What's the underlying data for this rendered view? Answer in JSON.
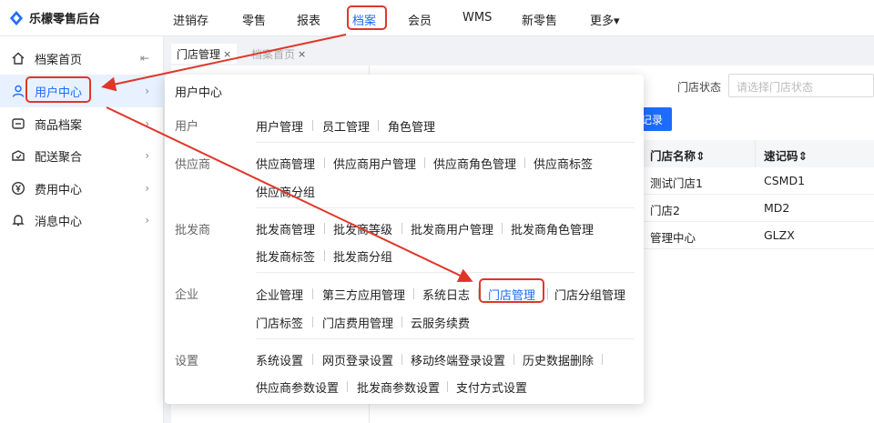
{
  "app": {
    "brand": "乐檬零售后台"
  },
  "topnav": [
    {
      "label": "进销存",
      "active": false
    },
    {
      "label": "零售",
      "active": false
    },
    {
      "label": "报表",
      "active": false
    },
    {
      "label": "档案",
      "active": true
    },
    {
      "label": "会员",
      "active": false
    },
    {
      "label": "WMS",
      "active": false
    },
    {
      "label": "新零售",
      "active": false
    },
    {
      "label": "更多▾",
      "active": false
    }
  ],
  "sidebar": {
    "items": [
      {
        "label": "档案首页",
        "icon": "home-icon",
        "arrow": "⇤"
      },
      {
        "label": "用户中心",
        "icon": "user-icon",
        "arrow": "›"
      },
      {
        "label": "商品档案",
        "icon": "product-icon",
        "arrow": "›"
      },
      {
        "label": "配送聚合",
        "icon": "delivery-icon",
        "arrow": "›"
      },
      {
        "label": "费用中心",
        "icon": "yen-icon",
        "arrow": "›"
      },
      {
        "label": "消息中心",
        "icon": "bell-icon",
        "arrow": "›"
      }
    ]
  },
  "tabs": [
    {
      "label": "门店管理",
      "close": "×"
    },
    {
      "label": "档案首页",
      "close": "×"
    }
  ],
  "filter": {
    "label": "门店状态",
    "placeholder": "请选择门店状态"
  },
  "record_button": "记录",
  "table": {
    "headers": [
      "门店名称⇕",
      "速记码⇕"
    ],
    "rows": [
      [
        "测试门店1",
        "CSMD1"
      ],
      [
        "门店2",
        "MD2"
      ],
      [
        "管理中心",
        "GLZX"
      ]
    ]
  },
  "panel": {
    "title": "用户中心",
    "groups": [
      {
        "label": "用户",
        "links": [
          "用户管理",
          "员工管理",
          "角色管理"
        ]
      },
      {
        "label": "供应商",
        "links": [
          "供应商管理",
          "供应商用户管理",
          "供应商角色管理",
          "供应商标签",
          "供应商分组"
        ]
      },
      {
        "label": "批发商",
        "links": [
          "批发商管理",
          "批发商等级",
          "批发商用户管理",
          "批发商角色管理",
          "批发商标签",
          "批发商分组"
        ]
      },
      {
        "label": "企业",
        "links": [
          "企业管理",
          "第三方应用管理",
          "系统日志",
          "门店管理",
          "门店分组管理",
          "门店标签",
          "门店费用管理",
          "云服务续费"
        ]
      },
      {
        "label": "设置",
        "links": [
          "系统设置",
          "网页登录设置",
          "移动终端登录设置",
          "历史数据删除",
          "供应商参数设置",
          "批发商参数设置",
          "支付方式设置"
        ]
      }
    ]
  },
  "colors": {
    "accent": "#1e6bff",
    "highlight": "#e0362a"
  }
}
